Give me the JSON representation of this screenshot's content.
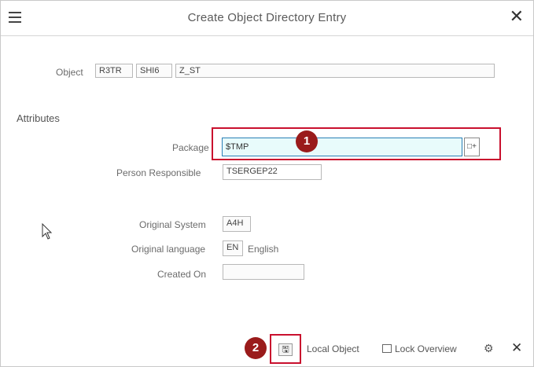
{
  "window": {
    "title": "Create Object Directory Entry"
  },
  "object": {
    "label": "Object",
    "v1": "R3TR",
    "v2": "SHI6",
    "v3": "Z_ST"
  },
  "attributes": {
    "heading": "Attributes",
    "package_label": "Package",
    "package_value": "$TMP",
    "package_help": "□+",
    "person_label": "Person Responsible",
    "person_value": "TSERGEP22",
    "orig_system_label": "Original System",
    "orig_system_value": "A4H",
    "orig_lang_label": "Original language",
    "orig_lang_code": "EN",
    "orig_lang_name": "English",
    "created_on_label": "Created On",
    "created_on_value": ""
  },
  "badges": {
    "one": "1",
    "two": "2"
  },
  "footer": {
    "save_glyph": "🖫",
    "local_object_label": "Local Object",
    "lock_overview_label": "Lock Overview",
    "tools_glyph": "⚙",
    "cancel_glyph": "✕"
  },
  "icons": {
    "menu": "menu-icon",
    "close": "close-icon",
    "save": "save-icon",
    "lock": "lock-icon",
    "settings": "settings-icon",
    "cursor": "mouse-cursor"
  },
  "colors": {
    "highlight": "#c9102e",
    "badge": "#9a1b1b",
    "input_focus": "#e8fbfb"
  }
}
